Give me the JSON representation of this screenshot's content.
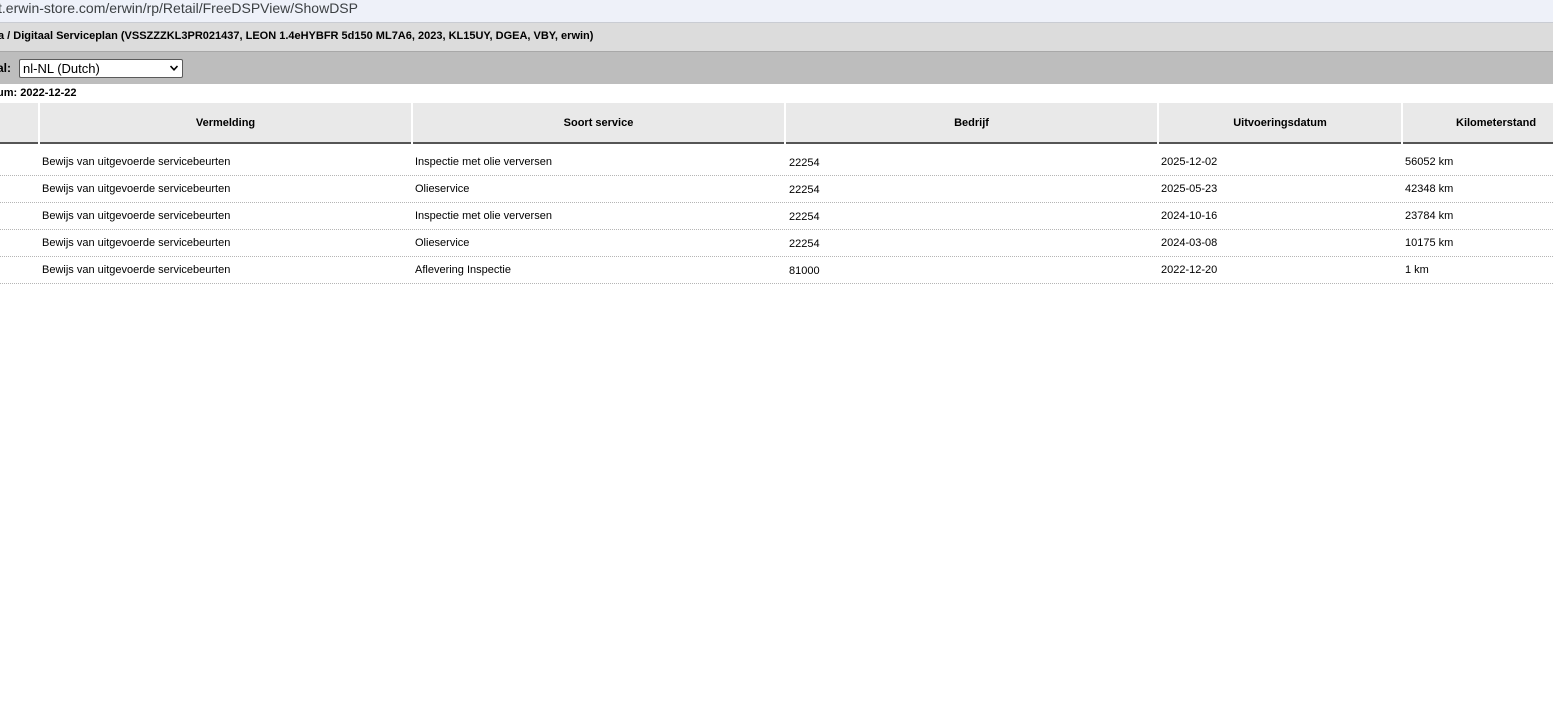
{
  "browser": {
    "url": "t.erwin-store.com/erwin/rp/Retail/FreeDSPView/ShowDSP"
  },
  "page": {
    "title": "a / Digitaal Serviceplan (VSSZZZKL3PR021437, LEON 1.4eHYBFR 5d150 ML7A6, 2023, KL15UY, DGEA, VBY, erwin)",
    "language_label": "al:",
    "language_selected": "nl-NL (Dutch)",
    "date_line": "um: 2022-12-22"
  },
  "table": {
    "headers": {
      "vermelding": "Vermelding",
      "soort_service": "Soort service",
      "bedrijf": "Bedrijf",
      "uitvoeringsdatum": "Uitvoeringsdatum",
      "kilometerstand": "Kilometerstand"
    },
    "rows": [
      {
        "vermelding": "Bewijs van uitgevoerde servicebeurten",
        "soort_service": "Inspectie met olie verversen",
        "bedrijf": "22254",
        "datum": "2025-12-02",
        "km": "56052 km"
      },
      {
        "vermelding": "Bewijs van uitgevoerde servicebeurten",
        "soort_service": "Olieservice",
        "bedrijf": "22254",
        "datum": "2025-05-23",
        "km": "42348 km"
      },
      {
        "vermelding": "Bewijs van uitgevoerde servicebeurten",
        "soort_service": "Inspectie met olie verversen",
        "bedrijf": "22254",
        "datum": "2024-10-16",
        "km": "23784 km"
      },
      {
        "vermelding": "Bewijs van uitgevoerde servicebeurten",
        "soort_service": "Olieservice",
        "bedrijf": "22254",
        "datum": "2024-03-08",
        "km": "10175 km"
      },
      {
        "vermelding": "Bewijs van uitgevoerde servicebeurten",
        "soort_service": "Aflevering Inspectie",
        "bedrijf": "81000",
        "datum": "2022-12-20",
        "km": "1 km"
      }
    ]
  }
}
